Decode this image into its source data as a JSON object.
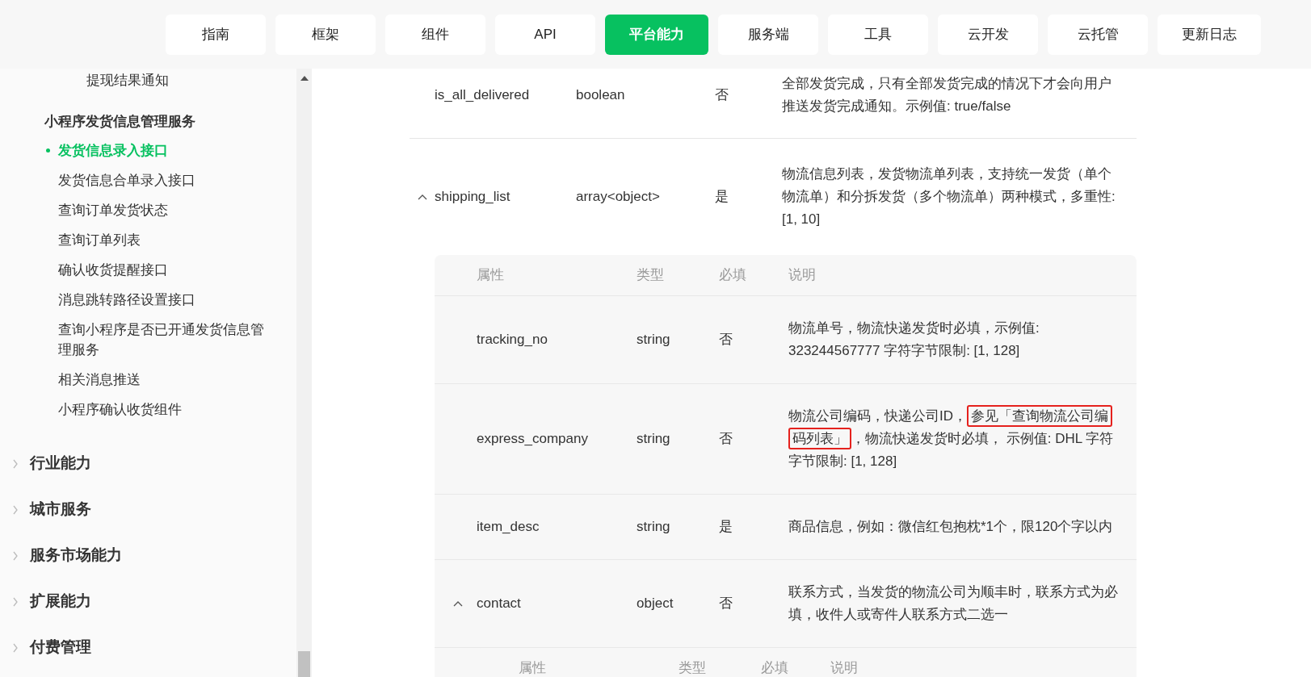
{
  "nav": [
    {
      "label": "指南",
      "selected": false
    },
    {
      "label": "框架",
      "selected": false
    },
    {
      "label": "组件",
      "selected": false
    },
    {
      "label": "API",
      "selected": false
    },
    {
      "label": "平台能力",
      "selected": true
    },
    {
      "label": "服务端",
      "selected": false
    },
    {
      "label": "工具",
      "selected": false
    },
    {
      "label": "云开发",
      "selected": false
    },
    {
      "label": "云托管",
      "selected": false
    },
    {
      "label": "更新日志",
      "selected": false
    }
  ],
  "sidebar": {
    "prior_items": [
      {
        "label": "提现结果通知",
        "selected": false
      }
    ],
    "group": {
      "title": "小程序发货信息管理服务",
      "items": [
        {
          "label": "发货信息录入接口",
          "selected": true
        },
        {
          "label": "发货信息合单录入接口",
          "selected": false
        },
        {
          "label": "查询订单发货状态",
          "selected": false
        },
        {
          "label": "查询订单列表",
          "selected": false
        },
        {
          "label": "确认收货提醒接口",
          "selected": false
        },
        {
          "label": "消息跳转路径设置接口",
          "selected": false
        },
        {
          "label": "查询小程序是否已开通发货信息管理服务",
          "selected": false
        },
        {
          "label": "相关消息推送",
          "selected": false
        },
        {
          "label": "小程序确认收货组件",
          "selected": false
        }
      ]
    },
    "sections": [
      {
        "label": "行业能力",
        "expanded": false
      },
      {
        "label": "城市服务",
        "expanded": false
      },
      {
        "label": "服务市场能力",
        "expanded": false
      },
      {
        "label": "扩展能力",
        "expanded": false
      },
      {
        "label": "付费管理",
        "expanded": false
      }
    ]
  },
  "table": {
    "rows": [
      {
        "name": "is_all_delivered",
        "type": "boolean",
        "required": "否",
        "description": [
          {
            "text": "全部发货完成，只有全部发货完成的情况下才会向用户推送发货完成通知。示例值: true/false",
            "highlighted": false
          }
        ]
      },
      {
        "name": "shipping_list",
        "type": "array<object>",
        "required": "是",
        "expanded": true,
        "description": [
          {
            "text": "物流信息列表，发货物流单列表，支持统一发货（单个物流单）和分拆发货（多个物流单）两种模式，多重性: [1, 10]",
            "highlighted": false
          }
        ],
        "children": {
          "columns": [
            "属性",
            "类型",
            "必填",
            "说明"
          ],
          "rows": [
            {
              "name": "tracking_no",
              "type": "string",
              "required": "否",
              "description": [
                {
                  "text": "物流单号，物流快递发货时必填，示例值: 323244567777 字符字节限制: [1, 128]",
                  "highlighted": false
                }
              ]
            },
            {
              "name": "express_company",
              "type": "string",
              "required": "否",
              "description": [
                {
                  "text": "物流公司编码，快递公司ID，",
                  "highlighted": false
                },
                {
                  "text": "参见「查询物流公司编码列表」",
                  "highlighted": true
                },
                {
                  "text": "，物流快递发货时必填， 示例值: DHL 字符字节限制: [1, 128]",
                  "highlighted": false
                }
              ]
            },
            {
              "name": "item_desc",
              "type": "string",
              "required": "是",
              "description": [
                {
                  "text": "商品信息，例如：微信红包抱枕*1个，限120个字以内",
                  "highlighted": false
                }
              ]
            },
            {
              "name": "contact",
              "type": "object",
              "required": "否",
              "expanded": true,
              "description": [
                {
                  "text": "联系方式，当发货的物流公司为顺丰时，联系方式为必填，收件人或寄件人联系方式二选一",
                  "highlighted": false
                }
              ],
              "children": {
                "columns": [
                  "属性",
                  "类型",
                  "必填",
                  "说明"
                ]
              }
            }
          ]
        }
      }
    ]
  }
}
